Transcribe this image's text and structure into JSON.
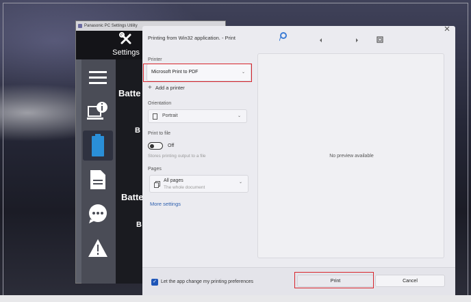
{
  "background_window": {
    "title": "Panasonic PC Settings Utility",
    "tab_label": "Settings",
    "headings": [
      "Batte",
      "B",
      "Batte",
      "B"
    ],
    "sidebar_icons": [
      "menu-icon",
      "pc-info-icon",
      "battery-icon",
      "document-icon",
      "chat-bubble-icon",
      "warning-icon"
    ]
  },
  "dialog": {
    "title": "Printing from Win32 application. - Print",
    "printer": {
      "label": "Printer",
      "selected": "Microsoft Print to PDF",
      "add_label": "Add a printer"
    },
    "orientation": {
      "label": "Orientation",
      "selected": "Portrait"
    },
    "print_to_file": {
      "label": "Print to file",
      "state": "Off",
      "description": "Stores printing output to a file"
    },
    "pages": {
      "label": "Pages",
      "selected": "All pages",
      "sub": "The whole document"
    },
    "more_settings": "More settings",
    "preview_text": "No preview available",
    "checkbox_label": "Let the app change my printing preferences",
    "print_button": "Print",
    "cancel_button": "Cancel"
  },
  "colors": {
    "highlight": "#d8232a",
    "checkbox": "#1f56b8",
    "dialog_bg": "#ebebf0"
  }
}
